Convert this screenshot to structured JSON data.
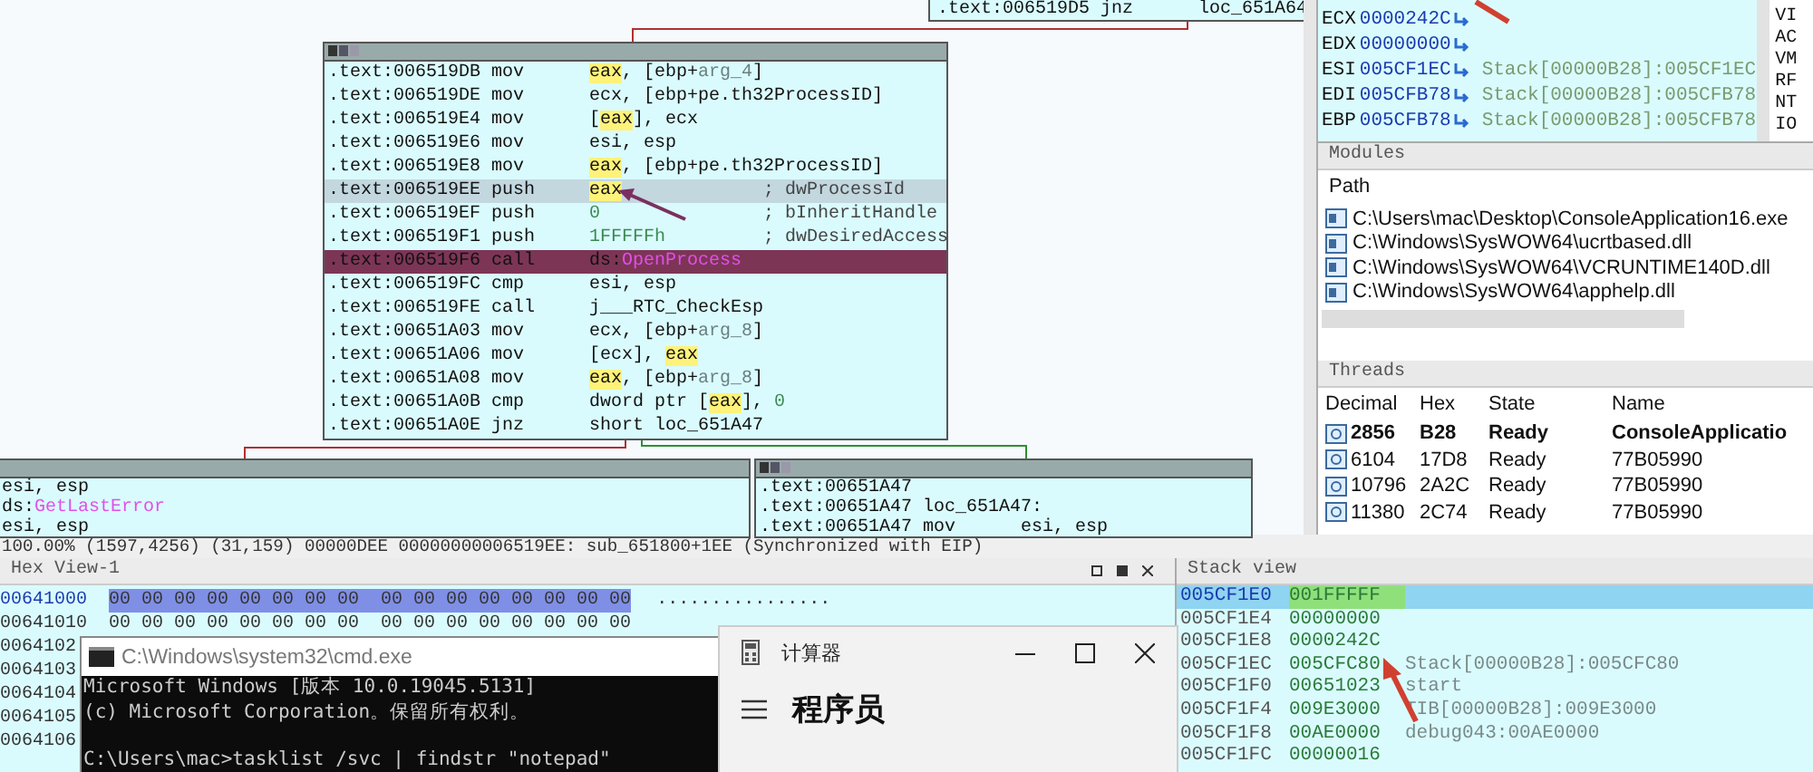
{
  "graph": {
    "top_node": {
      "lines": [
        {
          "addr": ".text:006519D5",
          "mnem": "jnz",
          "ops": [
            {
              "t": "loc_651A64",
              "kind": "plain"
            }
          ]
        }
      ]
    },
    "main_node": {
      "lines": [
        {
          "addr": ".text:006519DB",
          "mnem": "mov",
          "ops": [
            {
              "t": "eax",
              "kind": "hl"
            },
            {
              "t": ", [ebp+",
              "kind": "plain"
            },
            {
              "t": "arg_4",
              "kind": "var"
            },
            {
              "t": "]",
              "kind": "plain"
            }
          ],
          "selected": false,
          "eip": false
        },
        {
          "addr": ".text:006519DE",
          "mnem": "mov",
          "ops": [
            {
              "t": "ecx, [ebp+pe.th32ProcessID]",
              "kind": "plain"
            }
          ],
          "selected": false,
          "eip": false
        },
        {
          "addr": ".text:006519E4",
          "mnem": "mov",
          "ops": [
            {
              "t": "[",
              "kind": "plain"
            },
            {
              "t": "eax",
              "kind": "hl"
            },
            {
              "t": "], ecx",
              "kind": "plain"
            }
          ],
          "selected": false,
          "eip": false
        },
        {
          "addr": ".text:006519E6",
          "mnem": "mov",
          "ops": [
            {
              "t": "esi, esp",
              "kind": "plain"
            }
          ],
          "selected": false,
          "eip": false
        },
        {
          "addr": ".text:006519E8",
          "mnem": "mov",
          "ops": [
            {
              "t": "eax",
              "kind": "hl"
            },
            {
              "t": ", [ebp+pe.th32ProcessID]",
              "kind": "plain"
            }
          ],
          "selected": false,
          "eip": false
        },
        {
          "addr": ".text:006519EE",
          "mnem": "push",
          "ops": [
            {
              "t": "eax",
              "kind": "hl"
            }
          ],
          "comment": "; dwProcessId",
          "selected": true,
          "eip": false
        },
        {
          "addr": ".text:006519EF",
          "mnem": "push",
          "ops": [
            {
              "t": "0",
              "kind": "num"
            }
          ],
          "comment": "; bInheritHandle",
          "selected": false,
          "eip": false
        },
        {
          "addr": ".text:006519F1",
          "mnem": "push",
          "ops": [
            {
              "t": "1FFFFFh",
              "kind": "num"
            }
          ],
          "comment": "; dwDesiredAccess",
          "selected": false,
          "eip": false
        },
        {
          "addr": ".text:006519F6",
          "mnem": "call",
          "ops": [
            {
              "t": "ds:",
              "kind": "plain"
            },
            {
              "t": "OpenProcess",
              "kind": "import"
            }
          ],
          "selected": false,
          "eip": true
        },
        {
          "addr": ".text:006519FC",
          "mnem": "cmp",
          "ops": [
            {
              "t": "esi, esp",
              "kind": "plain"
            }
          ],
          "selected": false,
          "eip": false
        },
        {
          "addr": ".text:006519FE",
          "mnem": "call",
          "ops": [
            {
              "t": "j___RTC_CheckEsp",
              "kind": "plain"
            }
          ],
          "selected": false,
          "eip": false
        },
        {
          "addr": ".text:00651A03",
          "mnem": "mov",
          "ops": [
            {
              "t": "ecx, [ebp+",
              "kind": "plain"
            },
            {
              "t": "arg_8",
              "kind": "var"
            },
            {
              "t": "]",
              "kind": "plain"
            }
          ],
          "selected": false,
          "eip": false
        },
        {
          "addr": ".text:00651A06",
          "mnem": "mov",
          "ops": [
            {
              "t": "[ecx], ",
              "kind": "plain"
            },
            {
              "t": "eax",
              "kind": "hl"
            }
          ],
          "selected": false,
          "eip": false
        },
        {
          "addr": ".text:00651A08",
          "mnem": "mov",
          "ops": [
            {
              "t": "eax",
              "kind": "hl"
            },
            {
              "t": ", [ebp+",
              "kind": "plain"
            },
            {
              "t": "arg_8",
              "kind": "var"
            },
            {
              "t": "]",
              "kind": "plain"
            }
          ],
          "selected": false,
          "eip": false
        },
        {
          "addr": ".text:00651A0B",
          "mnem": "cmp",
          "ops": [
            {
              "t": "dword ptr [",
              "kind": "plain"
            },
            {
              "t": "eax",
              "kind": "hl"
            },
            {
              "t": "], ",
              "kind": "plain"
            },
            {
              "t": "0",
              "kind": "num"
            }
          ],
          "selected": false,
          "eip": false
        },
        {
          "addr": ".text:00651A0E",
          "mnem": "jnz",
          "ops": [
            {
              "t": "short loc_651A47",
              "kind": "plain"
            }
          ],
          "selected": false,
          "eip": false
        }
      ]
    },
    "left_node": {
      "lines": [
        {
          "ops": [
            {
              "t": "esi, esp",
              "kind": "plain"
            }
          ]
        },
        {
          "ops": [
            {
              "t": "ds:",
              "kind": "plain"
            },
            {
              "t": "GetLastError",
              "kind": "import"
            }
          ]
        },
        {
          "ops": [
            {
              "t": "esi, esp",
              "kind": "plain"
            }
          ]
        }
      ]
    },
    "right_node": {
      "lines": [
        {
          "addr": ".text:00651A47"
        },
        {
          "addr": ".text:00651A47",
          "ops": [
            {
              "t": "loc_651A47:",
              "kind": "plain"
            }
          ]
        },
        {
          "addr": ".text:00651A47",
          "mnem": "mov",
          "ops": [
            {
              "t": "esi, esp",
              "kind": "plain"
            }
          ]
        }
      ]
    }
  },
  "status_line": "100.00% (1597,4256) (31,159) 00000DEE 00000000006519EE: sub_651800+1EE (Synchronized with EIP)",
  "registers": {
    "rows": [
      {
        "name": "ECX",
        "value": "0000242C"
      },
      {
        "name": "EDX",
        "value": "00000000"
      },
      {
        "name": "ESI",
        "value": "005CF1EC",
        "info": "Stack[00000B28]:005CF1EC"
      },
      {
        "name": "EDI",
        "value": "005CFB78",
        "info": "Stack[00000B28]:005CFB78"
      },
      {
        "name": "EBP",
        "value": "005CFB78",
        "info": "Stack[00000B28]:005CFB78"
      }
    ],
    "flags": [
      "VI",
      "AC",
      "VM",
      "RF",
      "NT",
      "IO"
    ]
  },
  "modules": {
    "title": "Modules",
    "header": "Path",
    "items": [
      "C:\\Users\\mac\\Desktop\\ConsoleApplication16.exe",
      "C:\\Windows\\SysWOW64\\ucrtbased.dll",
      "C:\\Windows\\SysWOW64\\VCRUNTIME140D.dll",
      "C:\\Windows\\SysWOW64\\apphelp.dll"
    ]
  },
  "threads": {
    "title": "Threads",
    "columns": [
      "Decimal",
      "Hex",
      "State",
      "Name"
    ],
    "rows": [
      {
        "decimal": "2856",
        "hex": "B28",
        "state": "Ready",
        "name": "ConsoleApplicatio",
        "selected": true
      },
      {
        "decimal": "6104",
        "hex": "17D8",
        "state": "Ready",
        "name": "77B05990",
        "selected": false
      },
      {
        "decimal": "10796",
        "hex": "2A2C",
        "state": "Ready",
        "name": "77B05990",
        "selected": false
      },
      {
        "decimal": "11380",
        "hex": "2C74",
        "state": "Ready",
        "name": "77B05990",
        "selected": false
      }
    ]
  },
  "hex_view": {
    "title": "Hex View-1",
    "rows": [
      {
        "addr": "00641000",
        "bytes": "00 00 00 00 00 00 00 00  00 00 00 00 00 00 00 00",
        "ascii": "................",
        "selected": true
      },
      {
        "addr": "00641010",
        "bytes": "00 00 00 00 00 00 00 00  00 00 00 00 00 00 00 00",
        "selected": false
      },
      {
        "addr": "0064102",
        "selected": false
      },
      {
        "addr": "0064103",
        "selected": false
      },
      {
        "addr": "0064104",
        "selected": false
      },
      {
        "addr": "0064105",
        "selected": false
      },
      {
        "addr": "0064106",
        "selected": false
      }
    ]
  },
  "stack_view": {
    "title": "Stack view",
    "rows": [
      {
        "addr": "005CF1E0",
        "value": "001FFFFF",
        "selected": true
      },
      {
        "addr": "005CF1E4",
        "value": "00000000",
        "selected": false
      },
      {
        "addr": "005CF1E8",
        "value": "0000242C",
        "selected": false
      },
      {
        "addr": "005CF1EC",
        "value": "005CFC80",
        "info": "Stack[00000B28]:005CFC80",
        "selected": false
      },
      {
        "addr": "005CF1F0",
        "value": "00651023",
        "info": "start",
        "selected": false
      },
      {
        "addr": "005CF1F4",
        "value": "009E3000",
        "info": "TIB[00000B28]:009E3000",
        "selected": false
      },
      {
        "addr": "005CF1F8",
        "value": "00AE0000",
        "info": "debug043:00AE0000",
        "selected": false
      },
      {
        "addr": "005CF1FC",
        "value": "00000016",
        "selected": false
      }
    ]
  },
  "cmd_window": {
    "title": "C:\\Windows\\system32\\cmd.exe",
    "lines": [
      "Microsoft Windows [版本 10.0.19045.5131]",
      "(c) Microsoft Corporation。保留所有权利。",
      "C:\\Users\\mac>tasklist /svc | findstr \"notepad\""
    ]
  },
  "calculator_window": {
    "title": "计算器",
    "mode": "程序员"
  }
}
